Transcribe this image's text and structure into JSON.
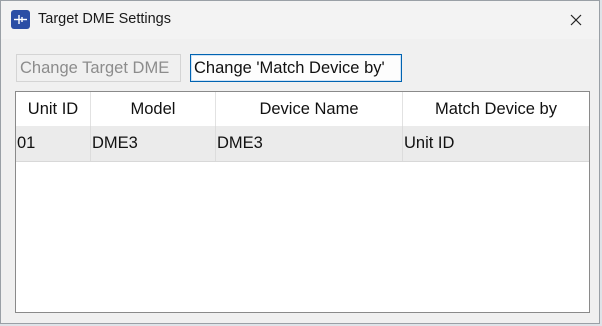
{
  "window": {
    "title": "Target DME Settings",
    "app_icon": "dme-app-icon",
    "close_icon": "close-icon"
  },
  "toolbar": {
    "change_target_label": "Change Target DME",
    "change_match_label": "Change 'Match Device by'"
  },
  "table": {
    "columns": [
      "Unit ID",
      "Model",
      "Device Name",
      "Match Device by"
    ],
    "rows": [
      [
        "01",
        "DME3",
        "DME3",
        "Unit ID"
      ]
    ]
  },
  "colors": {
    "accent_border": "#0063b1",
    "selected_row": "#ebebeb",
    "app_icon_bg": "#2b4ea5"
  }
}
